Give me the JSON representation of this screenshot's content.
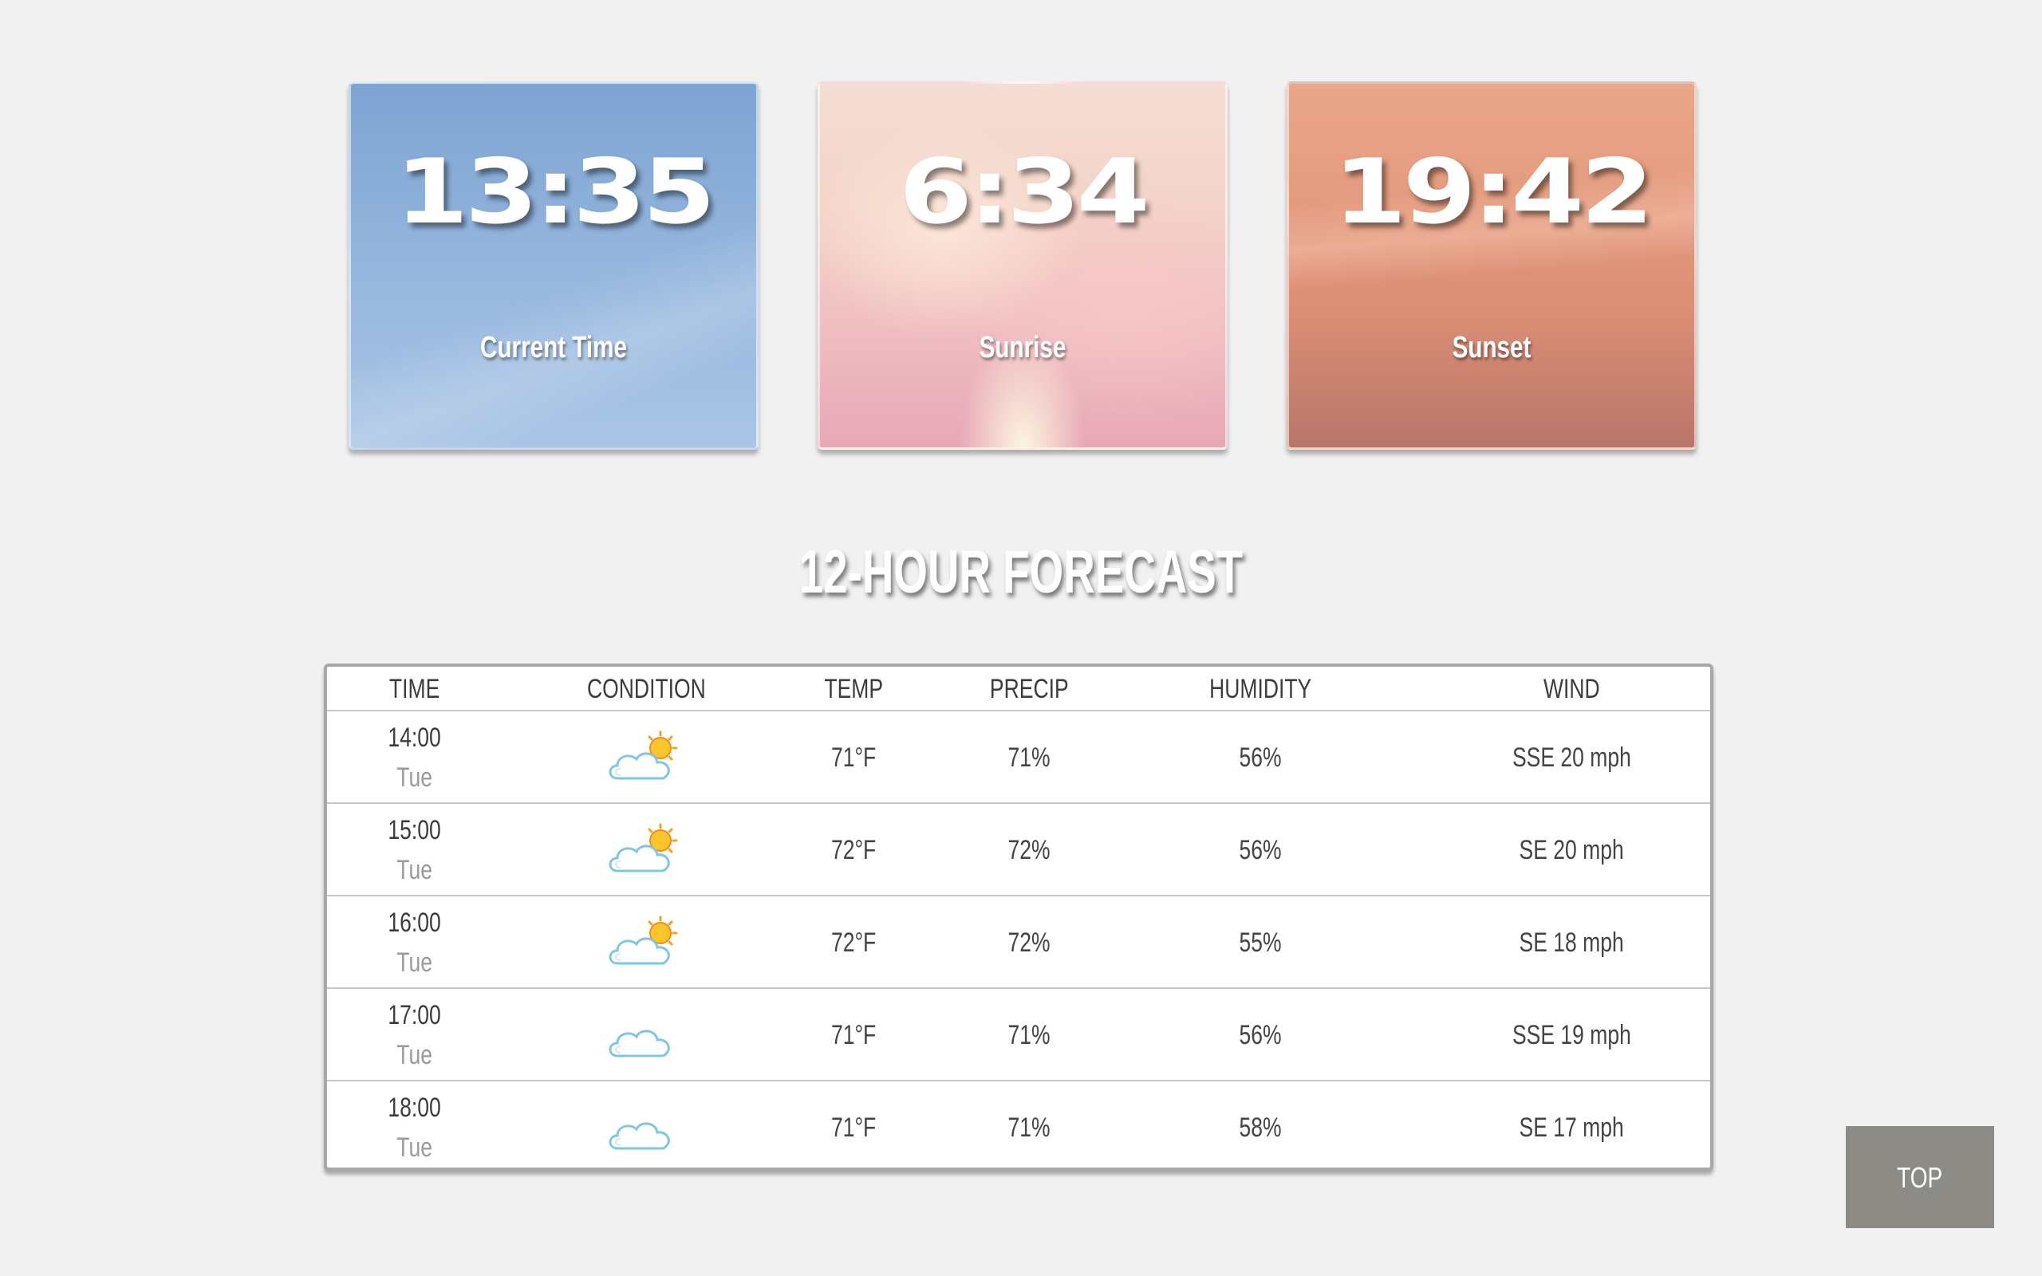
{
  "cards": [
    {
      "time": "13:35",
      "label": "Current Time"
    },
    {
      "time": "6:34",
      "label": "Sunrise"
    },
    {
      "time": "19:42",
      "label": "Sunset"
    }
  ],
  "forecast": {
    "title": "12-HOUR FORECAST",
    "headers": {
      "time": "TIME",
      "condition": "CONDITION",
      "temp": "TEMP",
      "precip": "PRECIP",
      "humidity": "HUMIDITY",
      "wind": "WIND"
    },
    "rows": [
      {
        "time": "14:00",
        "day": "Tue",
        "condition_icon": "partly-cloudy-icon",
        "temp": "71°F",
        "precip": "71%",
        "humidity": "56%",
        "wind": "SSE 20 mph"
      },
      {
        "time": "15:00",
        "day": "Tue",
        "condition_icon": "partly-cloudy-icon",
        "temp": "72°F",
        "precip": "72%",
        "humidity": "56%",
        "wind": "SE 20 mph"
      },
      {
        "time": "16:00",
        "day": "Tue",
        "condition_icon": "partly-cloudy-icon",
        "temp": "72°F",
        "precip": "72%",
        "humidity": "55%",
        "wind": "SE 18 mph"
      },
      {
        "time": "17:00",
        "day": "Tue",
        "condition_icon": "cloudy-icon",
        "temp": "71°F",
        "precip": "71%",
        "humidity": "56%",
        "wind": "SSE 19 mph"
      },
      {
        "time": "18:00",
        "day": "Tue",
        "condition_icon": "cloudy-icon",
        "temp": "71°F",
        "precip": "71%",
        "humidity": "58%",
        "wind": "SE 17 mph"
      }
    ]
  },
  "top_button": {
    "label": "TOP"
  },
  "colors": {
    "background": "#f1f1f1",
    "card_current": "#8fb0da",
    "card_sunrise": "#f0c6c2",
    "card_sunset": "#df9579",
    "top_button": "#8c8b86"
  }
}
